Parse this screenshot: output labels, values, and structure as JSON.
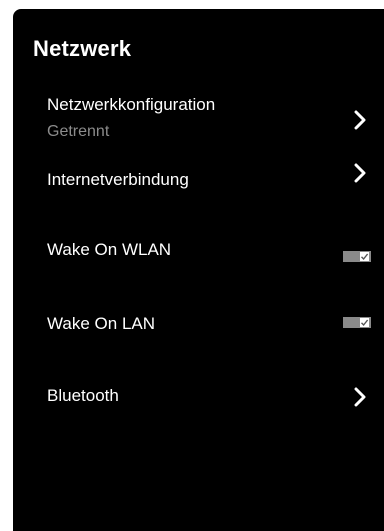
{
  "header": {
    "title": "Netzwerk"
  },
  "rows": [
    {
      "label": "Netzwerkkonfiguration",
      "sublabel": "Getrennt",
      "control": "chevron",
      "icon": "chevron-right-icon"
    },
    {
      "label": "Internetverbindung",
      "control": "chevron",
      "icon": "chevron-right-icon"
    },
    {
      "label": "Wake On WLAN",
      "control": "checkbox",
      "checked": true,
      "icon": "checkbox-checked-icon"
    },
    {
      "label": "Wake On LAN",
      "control": "checkbox",
      "checked": true,
      "icon": "checkbox-checked-icon"
    },
    {
      "label": "Bluetooth",
      "control": "chevron",
      "icon": "chevron-right-icon"
    }
  ],
  "colors": {
    "panel_background": "#000000",
    "text": "#ffffff",
    "secondary_text": "#8c8c8c",
    "toggle_track": "#8a8a8a"
  }
}
